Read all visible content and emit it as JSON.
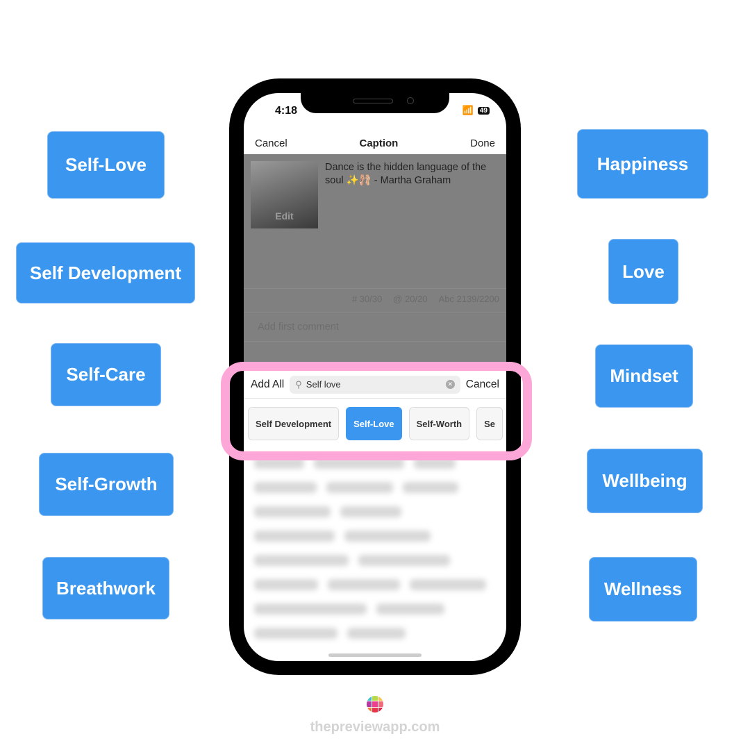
{
  "tags_left": [
    "Self-Love",
    "Self Development",
    "Self-Care",
    "Self-Growth",
    "Breathwork"
  ],
  "tags_right": [
    "Happiness",
    "Love",
    "Mindset",
    "Wellbeing",
    "Wellness"
  ],
  "status": {
    "time": "4:18",
    "battery": "49"
  },
  "nav": {
    "cancel": "Cancel",
    "title": "Caption",
    "done": "Done"
  },
  "post": {
    "thumb_label": "Edit",
    "caption": "Dance is the hidden language of the soul ✨🩰 - Martha Graham"
  },
  "counts": {
    "hashtags": "# 30/30",
    "mentions": "@ 20/20",
    "chars": "Abc 2139/2200"
  },
  "comment_placeholder": "Add first comment",
  "search": {
    "add_all": "Add All",
    "query": "Self love",
    "cancel": "Cancel"
  },
  "chips": [
    {
      "label": "Self Development",
      "selected": false
    },
    {
      "label": "Self-Love",
      "selected": true
    },
    {
      "label": "Self-Worth",
      "selected": false
    },
    {
      "label": "Se",
      "selected": false
    }
  ],
  "highlight_color": "#fda7d8",
  "accent_color": "#3a96ee",
  "footer": "thepreviewapp.com"
}
